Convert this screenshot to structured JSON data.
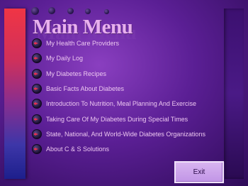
{
  "title": "Main Menu",
  "menu": {
    "items": [
      {
        "label": "My Health Care Providers"
      },
      {
        "label": "My Daily Log"
      },
      {
        "label": "My Diabetes Recipes"
      },
      {
        "label": "Basic Facts About Diabetes"
      },
      {
        "label": "Introduction To Nutrition, Meal Planning And Exercise"
      },
      {
        "label": "Taking Care Of My Diabetes During Special Times"
      },
      {
        "label": "State, National, And World-Wide Diabetes Organizations"
      },
      {
        "label": "About C & S Solutions"
      }
    ]
  },
  "exit_label": "Exit",
  "colors": {
    "background": "#5b1f95",
    "title": "#e8b0ee",
    "menu_text": "#ecc6f0",
    "bullet_arrow": "#e23050",
    "exit_button": "#c195e6"
  },
  "icons": {
    "menu_bullet": "arrow-bullet-icon",
    "title_decoration": "dot-icon"
  }
}
